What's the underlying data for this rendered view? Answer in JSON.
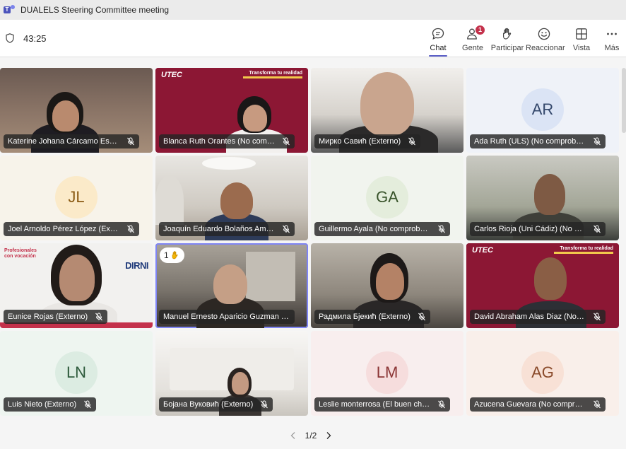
{
  "titlebar": {
    "title": "DUALELS Steering Committee meeting"
  },
  "toolbar": {
    "timer": "43:25",
    "buttons": [
      {
        "label": "Chat",
        "icon": "chat-icon"
      },
      {
        "label": "Gente",
        "icon": "people-icon",
        "badge": "1"
      },
      {
        "label": "Participar",
        "icon": "raise-hand-icon"
      },
      {
        "label": "Reaccionar",
        "icon": "emoji-icon"
      },
      {
        "label": "Vista",
        "icon": "grid-view-icon"
      },
      {
        "label": "Más",
        "icon": "more-icon"
      }
    ]
  },
  "participants": [
    {
      "name": "Katerine Johana Cárcamo Escole...",
      "type": "video"
    },
    {
      "name": "Blanca Ruth Orantes (No compro...",
      "type": "video"
    },
    {
      "name": "Мирко Савић (Externo)",
      "type": "video"
    },
    {
      "name": "Ada Ruth (ULS) (No comprobado)",
      "type": "avatar",
      "initials": "AR",
      "avatar_bg": "#dbe4f5",
      "avatar_fg": "#33476b"
    },
    {
      "name": "Joel Arnoldo Pérez López (Externo)",
      "type": "avatar",
      "initials": "JL",
      "avatar_bg": "#fbeac9",
      "avatar_fg": "#8a5a13"
    },
    {
      "name": "Joaquín Eduardo Bolaños Amaya ...",
      "type": "video"
    },
    {
      "name": "Guillermo Ayala (No comprobado)",
      "type": "avatar",
      "initials": "GA",
      "avatar_bg": "#e4eddc",
      "avatar_fg": "#38532a"
    },
    {
      "name": "Carlos Rioja (Uni Cádiz) (No com...",
      "type": "video"
    },
    {
      "name": "Eunice Rojas (Externo)",
      "type": "video"
    },
    {
      "name": "Manuel Ernesto Aparicio Guzman (Ext...",
      "type": "video",
      "hand": "1",
      "selected": true
    },
    {
      "name": "Радмила Бјекић (Externo)",
      "type": "video"
    },
    {
      "name": "David Abraham Alas Diaz (No co...",
      "type": "video"
    },
    {
      "name": "Luis Nieto (Externo)",
      "type": "avatar",
      "initials": "LN",
      "avatar_bg": "#dcece2",
      "avatar_fg": "#2d5a3b"
    },
    {
      "name": "Бојана Вуковић (Externo)",
      "type": "video"
    },
    {
      "name": "Leslie monterrosa (El buen chocol...",
      "type": "avatar",
      "initials": "LM",
      "avatar_bg": "#f6dddd",
      "avatar_fg": "#8a3434"
    },
    {
      "name": "Azucena Guevara (No comproba...",
      "type": "avatar",
      "initials": "AG",
      "avatar_bg": "#f8e1d6",
      "avatar_fg": "#8a4a2a"
    }
  ],
  "tile_text": {
    "utec_logo": "UTEC",
    "utec_slogan": "Transforma tu realidad",
    "promo_text": "Profesionales con vocación",
    "promo_logo": "DIRNI"
  },
  "pager": {
    "label": "1/2"
  }
}
